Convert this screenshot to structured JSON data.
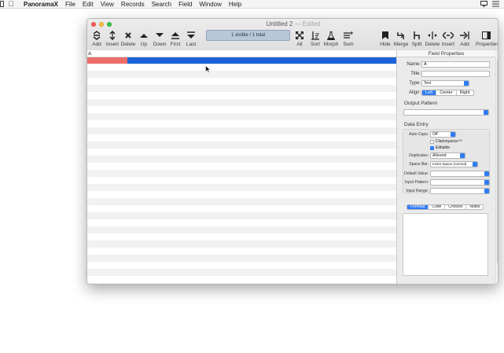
{
  "menubar": {
    "app_name": "PanoramaX",
    "items": [
      "File",
      "Edit",
      "View",
      "Records",
      "Search",
      "Field",
      "Window",
      "Help"
    ]
  },
  "window": {
    "title": "Untitled 2",
    "edited": "— Edited"
  },
  "toolbar": {
    "left": [
      {
        "id": "add",
        "label": "Add",
        "icon": "add-record-icon"
      },
      {
        "id": "insert",
        "label": "Insert",
        "icon": "insert-record-icon"
      },
      {
        "id": "delete",
        "label": "Delete",
        "icon": "delete-record-icon"
      },
      {
        "id": "up",
        "label": "Up",
        "icon": "up-icon"
      },
      {
        "id": "down",
        "label": "Down",
        "icon": "down-icon"
      },
      {
        "id": "first",
        "label": "First",
        "icon": "first-icon"
      },
      {
        "id": "last",
        "label": "Last",
        "icon": "last-icon"
      }
    ],
    "status": "1 visible / 1 total",
    "middle": [
      {
        "id": "all",
        "label": "All",
        "icon": "expand-all-icon"
      },
      {
        "id": "sort",
        "label": "Sort",
        "icon": "sort-icon"
      },
      {
        "id": "morph",
        "label": "Morph",
        "icon": "flask-icon"
      },
      {
        "id": "sum",
        "label": "Sum",
        "icon": "sum-icon"
      }
    ],
    "right": [
      {
        "id": "hide",
        "label": "Hide",
        "icon": "bookmark-icon"
      },
      {
        "id": "merge",
        "label": "Merge",
        "icon": "merge-icon"
      },
      {
        "id": "split",
        "label": "Split",
        "icon": "split-icon"
      },
      {
        "id": "delete-field",
        "label": "Delete",
        "icon": "delete-field-icon"
      },
      {
        "id": "insert-field",
        "label": "Insert",
        "icon": "insert-field-icon"
      },
      {
        "id": "add-field",
        "label": "Add",
        "icon": "add-field-icon"
      },
      {
        "id": "properties",
        "label": "Properties",
        "icon": "sidebar-icon"
      }
    ]
  },
  "sheet": {
    "column_name": "A",
    "colors": {
      "field_bar": "#1a63d6",
      "selected_cell": "#ec6c6a"
    }
  },
  "properties": {
    "title": "Field Properties",
    "name_label": "Name:",
    "name_value": "A",
    "title_label": "Title:",
    "title_value": "",
    "type_label": "Type:",
    "type_value": "Text",
    "align_label": "Align:",
    "align_options": [
      "Left",
      "Center",
      "Right"
    ],
    "align_selected": "Left",
    "output_pattern_label": "Output Pattern",
    "output_pattern_value": "",
    "data_entry_label": "Data Entry",
    "autocaps_label": "Auto Caps:",
    "autocaps_value": "Off",
    "clairvoyance_label": "Clairvoyance™",
    "editable_label": "Editable",
    "duplicates_label": "Duplicates:",
    "duplicates_value": "Allowed",
    "spacebar_label": "Space Bar:",
    "spacebar_value": "Insert Space (normal)",
    "default_value_label": "Default Value:",
    "input_pattern_label": "Input Pattern:",
    "input_range_label": "Input Range:",
    "tabs": [
      "Formula",
      "Code",
      "Choices",
      "Notes"
    ],
    "tab_selected": "Formula"
  }
}
